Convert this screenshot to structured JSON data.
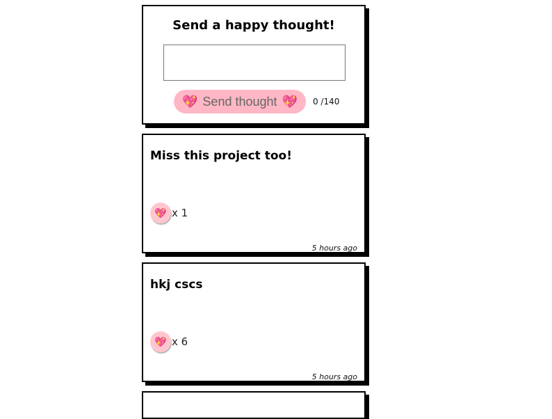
{
  "composer": {
    "title": "Send a happy thought!",
    "input_value": "",
    "input_placeholder": "",
    "send_label": "Send thought",
    "heart_emoji": "💖",
    "counter": "0 /140"
  },
  "thoughts": [
    {
      "message": "Miss this project too!",
      "heart_emoji": "💖",
      "likes": "x 1",
      "time": "5 hours ago"
    },
    {
      "message": "hkj cscs",
      "heart_emoji": "💖",
      "likes": "x 6",
      "time": "5 hours ago"
    }
  ],
  "colors": {
    "button_pink": "#ffb7c5",
    "like_pink": "#ffc6d0",
    "shadow": "#000000"
  }
}
